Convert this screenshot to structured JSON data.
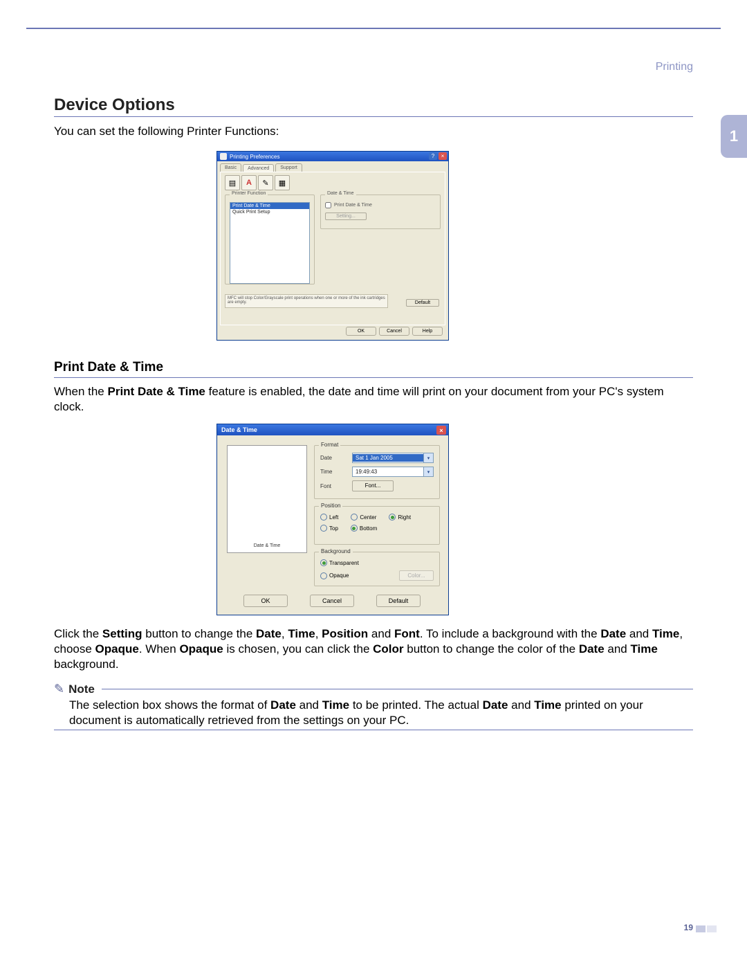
{
  "header": {
    "category": "Printing"
  },
  "chapter": {
    "number": "1"
  },
  "page": {
    "number": "19"
  },
  "section": {
    "title": "Device Options",
    "intro": "You can set the following Printer Functions:"
  },
  "dialog1": {
    "title": "Printing Preferences",
    "tabs": [
      "Basic",
      "Advanced",
      "Support"
    ],
    "active_tab_index": 1,
    "printer_function": {
      "label": "Printer Function",
      "items": [
        "Print Date & Time",
        "Quick Print Setup"
      ],
      "selected_index": 0
    },
    "date_time_group": {
      "label": "Date & Time",
      "checkbox": "Print Date & Time",
      "setting_btn": "Setting..."
    },
    "note": "MFC will stop Color/Grayscale print operations when one or more of the ink cartridges are empty.",
    "default_btn": "Default",
    "buttons": [
      "OK",
      "Cancel",
      "Help"
    ]
  },
  "subsection": {
    "title": "Print Date & Time",
    "para_before": "When the ",
    "para_feature": "Print Date & Time",
    "para_after": " feature is enabled, the date and time will print on your document from your PC's system clock."
  },
  "dialog2": {
    "title": "Date & Time",
    "preview_label": "Date & Time",
    "format": {
      "label": "Format",
      "date_label": "Date",
      "date_value": "Sat 1 Jan 2005",
      "time_label": "Time",
      "time_value": "19:49:43",
      "font_label": "Font",
      "font_btn": "Font..."
    },
    "position": {
      "label": "Position",
      "row1": [
        "Left",
        "Center",
        "Right"
      ],
      "row1_selected": 2,
      "row2": [
        "Top",
        "Bottom"
      ],
      "row2_selected": 1
    },
    "background": {
      "label": "Background",
      "options": [
        "Transparent",
        "Opaque"
      ],
      "selected": 0,
      "color_btn": "Color..."
    },
    "buttons": [
      "OK",
      "Cancel",
      "Default"
    ]
  },
  "para2": {
    "segments": [
      {
        "t": "Click the ",
        "b": false
      },
      {
        "t": "Setting",
        "b": true
      },
      {
        "t": " button to change the ",
        "b": false
      },
      {
        "t": "Date",
        "b": true
      },
      {
        "t": ", ",
        "b": false
      },
      {
        "t": "Time",
        "b": true
      },
      {
        "t": ", ",
        "b": false
      },
      {
        "t": "Position",
        "b": true
      },
      {
        "t": " and ",
        "b": false
      },
      {
        "t": "Font",
        "b": true
      },
      {
        "t": ". To include a background with the ",
        "b": false
      },
      {
        "t": "Date",
        "b": true
      },
      {
        "t": " and ",
        "b": false
      },
      {
        "t": "Time",
        "b": true
      },
      {
        "t": ", choose ",
        "b": false
      },
      {
        "t": "Opaque",
        "b": true
      },
      {
        "t": ". When ",
        "b": false
      },
      {
        "t": "Opaque",
        "b": true
      },
      {
        "t": " is chosen, you can click the ",
        "b": false
      },
      {
        "t": "Color",
        "b": true
      },
      {
        "t": " button to change the color of the ",
        "b": false
      },
      {
        "t": "Date",
        "b": true
      },
      {
        "t": " and ",
        "b": false
      },
      {
        "t": "Time",
        "b": true
      },
      {
        "t": " background.",
        "b": false
      }
    ]
  },
  "note": {
    "label": "Note",
    "segments": [
      {
        "t": "The selection box shows the format of ",
        "b": false
      },
      {
        "t": "Date",
        "b": true
      },
      {
        "t": " and ",
        "b": false
      },
      {
        "t": "Time",
        "b": true
      },
      {
        "t": " to be printed. The actual ",
        "b": false
      },
      {
        "t": "Date",
        "b": true
      },
      {
        "t": " and ",
        "b": false
      },
      {
        "t": "Time",
        "b": true
      },
      {
        "t": " printed on your document is automatically retrieved from the settings on your PC.",
        "b": false
      }
    ]
  }
}
